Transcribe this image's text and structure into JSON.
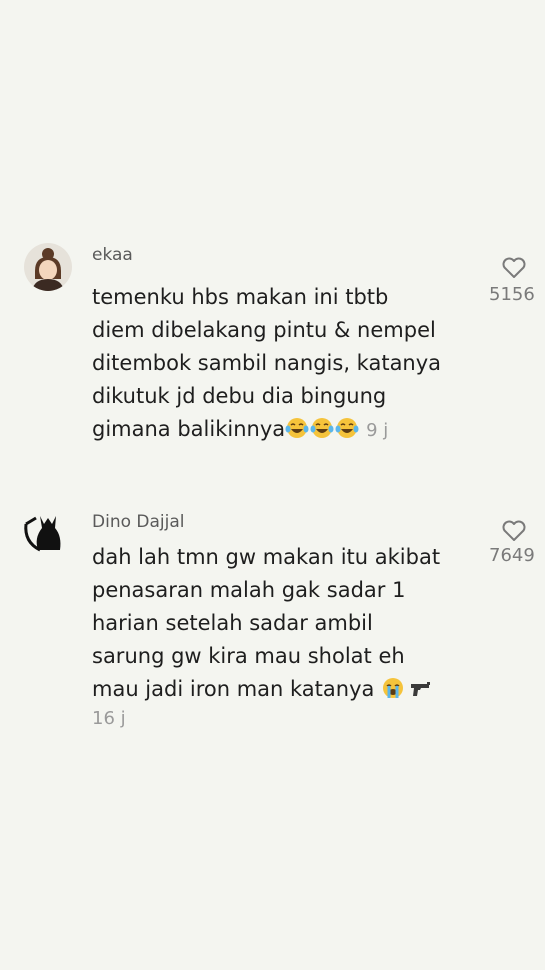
{
  "comments": [
    {
      "username": "ekaa",
      "lines": [
        "temenku hbs makan ini tbtb",
        "diem dibelakang pintu & nempel",
        "ditembok sambil nangis, katanya",
        "dikutuk jd debu dia bingung",
        "gimana balikinnya"
      ],
      "emoji": [
        "face-with-tears-of-joy",
        "face-with-tears-of-joy",
        "face-with-tears-of-joy"
      ],
      "time": "9 j",
      "likes": "5156",
      "like_icon": "heart-outline-icon"
    },
    {
      "username": "Dino Dajjal",
      "lines": [
        "dah lah tmn gw makan itu akibat",
        "penasaran malah gak sadar 1",
        "harian setelah sadar ambil",
        "sarung gw kira mau sholat eh",
        "mau jadi iron man katanya"
      ],
      "emoji": [
        "loudly-crying-face",
        "pistol"
      ],
      "time": "16 j",
      "likes": "7649",
      "like_icon": "heart-outline-icon"
    }
  ]
}
